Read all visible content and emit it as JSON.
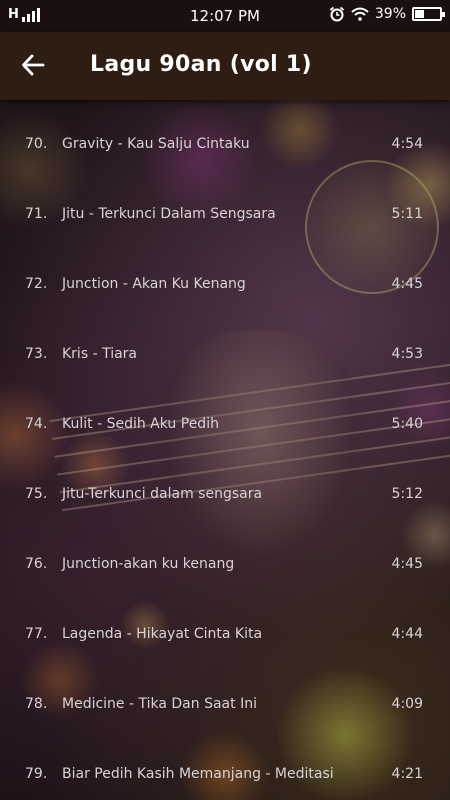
{
  "status_bar": {
    "network": "H",
    "time": "12:07 PM",
    "battery_percent": "39%",
    "battery_level": 0.39
  },
  "app_bar": {
    "title": "Lagu 90an (vol 1)",
    "back_icon": "arrow-left-icon"
  },
  "songs": [
    {
      "num": "70.",
      "title": "Gravity - Kau Salju Cintaku",
      "duration": "4:54"
    },
    {
      "num": "71.",
      "title": "Jitu - Terkunci Dalam Sengsara",
      "duration": "5:11"
    },
    {
      "num": "72.",
      "title": "Junction - Akan Ku Kenang",
      "duration": "4:45"
    },
    {
      "num": "73.",
      "title": "Kris - Tiara",
      "duration": "4:53"
    },
    {
      "num": "74.",
      "title": "Kulit - Sedih Aku Pedih",
      "duration": "5:40"
    },
    {
      "num": "75.",
      "title": "Jitu-Terkunci dalam sengsara",
      "duration": "5:12"
    },
    {
      "num": "76.",
      "title": "Junction-akan ku kenang",
      "duration": "4:45"
    },
    {
      "num": "77.",
      "title": "Lagenda - Hikayat Cinta Kita",
      "duration": "4:44"
    },
    {
      "num": "78.",
      "title": "Medicine - Tika Dan Saat Ini",
      "duration": "4:09"
    },
    {
      "num": "79.",
      "title": "Biar Pedih Kasih Memanjang - Meditasi",
      "duration": "4:21"
    }
  ]
}
